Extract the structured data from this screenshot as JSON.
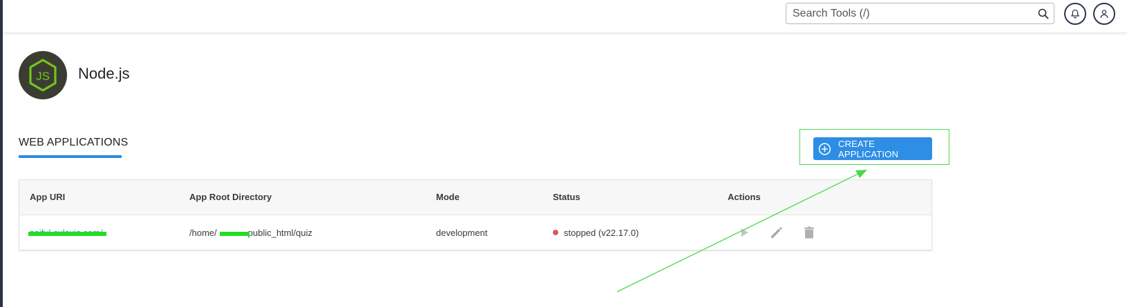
{
  "header": {
    "search_placeholder": "Search Tools (/)"
  },
  "page": {
    "title": "Node.js",
    "logo_text": "JS"
  },
  "section": {
    "tab_label": "WEB APPLICATIONS",
    "create_button_label": "CREATE APPLICATION"
  },
  "table": {
    "columns": [
      "App URI",
      "App Root Directory",
      "Mode",
      "Status",
      "Actions"
    ],
    "rows": [
      {
        "app_uri": "saiful.oxlaxis.com/",
        "root_dir_prefix": "/home/",
        "root_dir_suffix": "public_html/quiz",
        "mode": "development",
        "status": "stopped (v22.17.0)"
      }
    ]
  },
  "colors": {
    "accent": "#2e8ee5",
    "annotation": "#4cd94c",
    "status_stopped": "#e0556a",
    "logo_bg": "#3b3d33",
    "logo_fg": "#76c51c"
  },
  "icons": {
    "search": "search-icon",
    "bell": "bell-icon",
    "user": "user-icon",
    "create": "plus-circle-icon",
    "start": "play-icon",
    "edit": "pencil-icon",
    "delete": "trash-icon"
  }
}
